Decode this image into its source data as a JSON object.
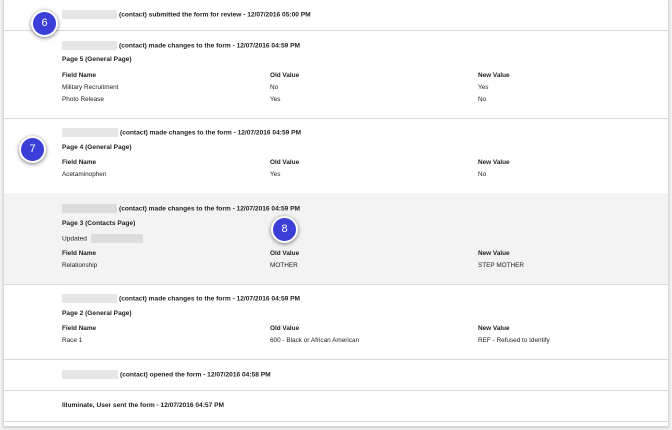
{
  "badges": [
    "6",
    "7",
    "8"
  ],
  "columns": {
    "field": "Field Name",
    "old": "Old Value",
    "new": "New Value"
  },
  "entry1": {
    "text": "(contact) submitted the form for review - 12/07/2016 05:00 PM"
  },
  "entry2": {
    "text": "(contact) made changes to the form - 12/07/2016 04:59 PM",
    "page": "Page 5 (General Page)",
    "rows": [
      {
        "field": "Military Recruitment",
        "old": "No",
        "new": "Yes"
      },
      {
        "field": "Photo Release",
        "old": "Yes",
        "new": "No"
      }
    ]
  },
  "entry3": {
    "text": "(contact) made changes to the form - 12/07/2016 04:59 PM",
    "page": "Page 4 (General Page)",
    "rows": [
      {
        "field": "Acetaminophen",
        "old": "Yes",
        "new": "No"
      }
    ]
  },
  "entry4": {
    "text": "(contact) made changes to the form - 12/07/2016 04:59 PM",
    "page": "Page 3 (Contacts Page)",
    "updated": "Updated",
    "rows": [
      {
        "field": "Relationship",
        "old": "MOTHER",
        "new": "STEP MOTHER"
      }
    ]
  },
  "entry5": {
    "text": "(contact) made changes to the form - 12/07/2016 04:59 PM",
    "page": "Page 2 (General Page)",
    "rows": [
      {
        "field": "Race 1",
        "old": "600 - Black or African American",
        "new": "REF - Refused to Identify"
      }
    ]
  },
  "entry6": {
    "text": "(contact) opened the form - 12/07/2016 04:58 PM"
  },
  "entry7": {
    "text": "Illuminate, User sent the form - 12/07/2016 04:57 PM"
  }
}
